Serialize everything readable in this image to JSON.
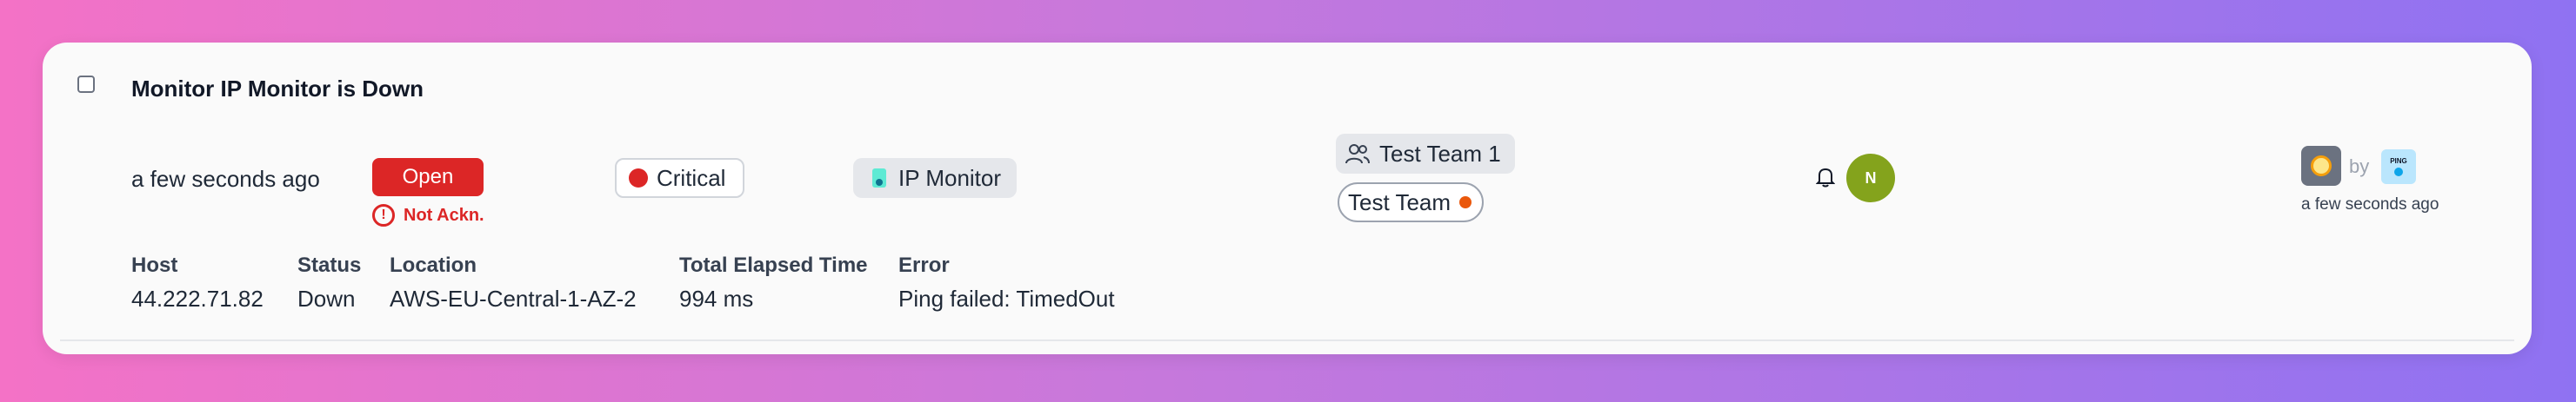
{
  "incident": {
    "title": "Monitor IP Monitor is Down",
    "time_ago": "a few seconds ago",
    "state": "Open",
    "ack_status": "Not Ackn.",
    "severity": "Critical",
    "severity_color": "#dc2626",
    "monitor": "IP Monitor",
    "teams": [
      {
        "name": "Test Team 1"
      },
      {
        "name": "Test Team"
      }
    ],
    "assignee_initial": "N",
    "assignee_color": "#84a31c",
    "source": {
      "by_label": "by",
      "time_ago": "a few seconds ago",
      "integration_icon_text": "PING"
    }
  },
  "details": {
    "headers": [
      "Host",
      "Status",
      "Location",
      "Total Elapsed Time",
      "Error"
    ],
    "values": [
      "44.222.71.82",
      "Down",
      "AWS-EU-Central-1-AZ-2",
      "994 ms",
      "Ping failed: TimedOut"
    ]
  },
  "icons": {
    "checkbox": "checkbox-icon",
    "alert": "alert-circle-icon",
    "team": "users-icon",
    "bell": "bell-icon"
  }
}
